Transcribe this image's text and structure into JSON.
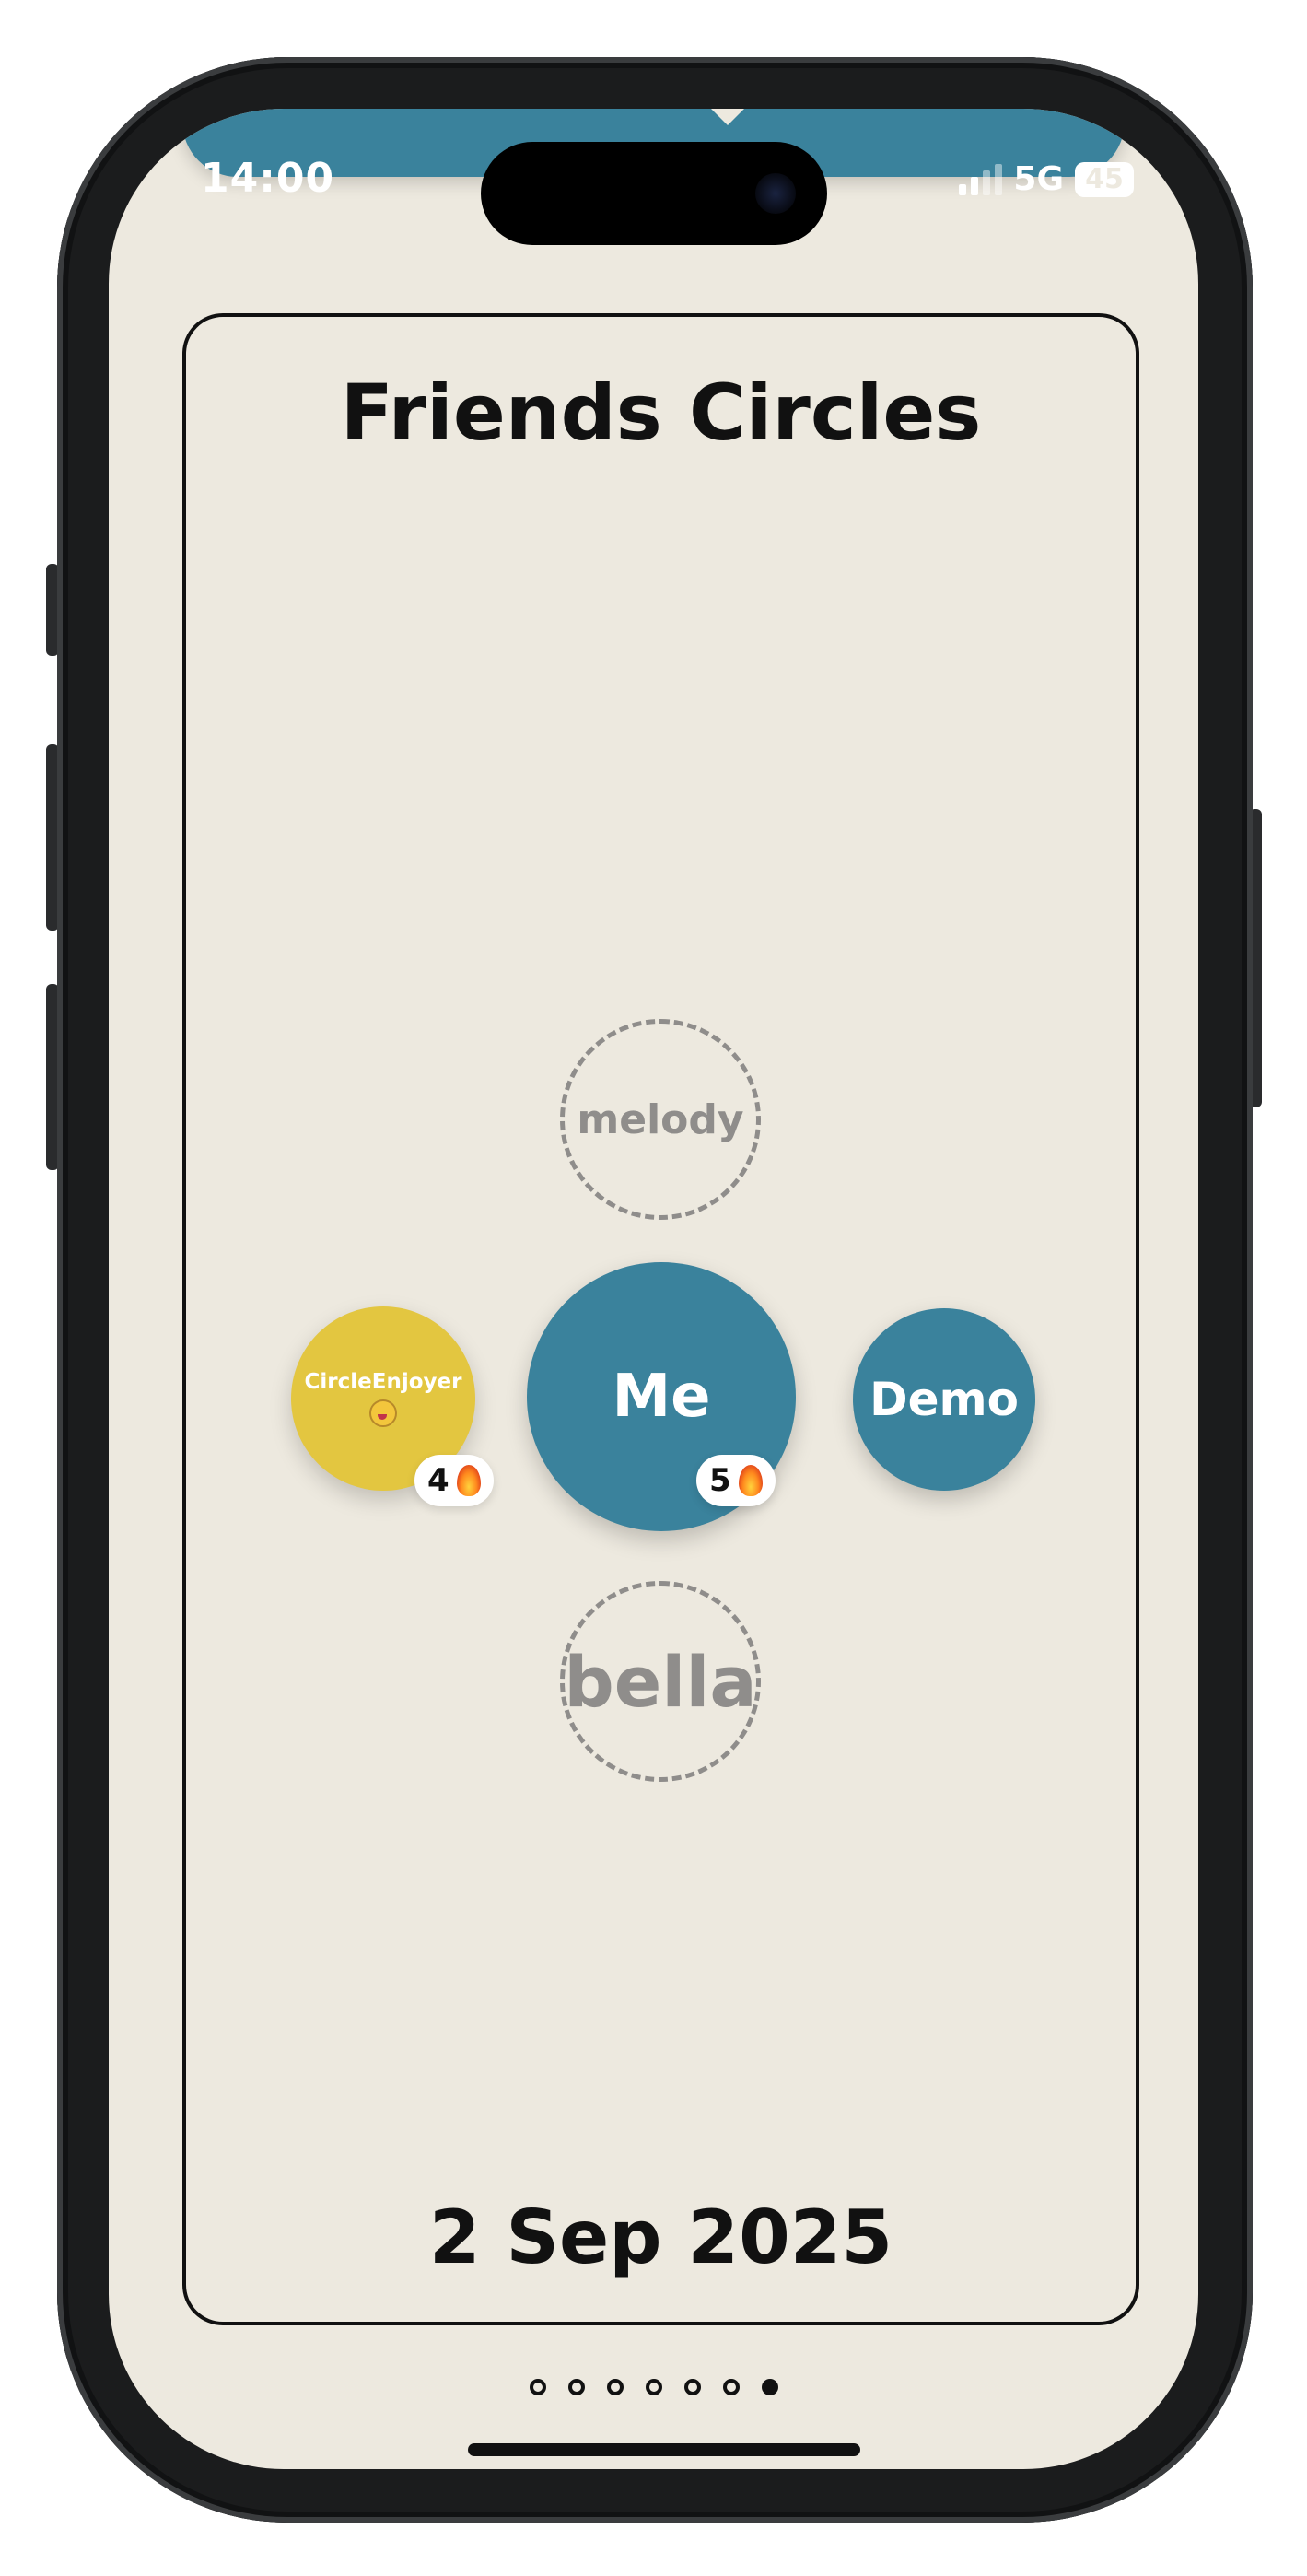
{
  "status_bar": {
    "time": "14:00",
    "network": "5G",
    "battery": "45"
  },
  "card": {
    "title": "Friends Circles",
    "date": "2 Sep 2025"
  },
  "circles": {
    "center": {
      "label": "Me",
      "streak": "5",
      "streak_icon": "fire-icon",
      "color": "#3a829c"
    },
    "top": {
      "label": "melody",
      "state": "pending"
    },
    "bottom": {
      "label": "bella",
      "state": "pending"
    },
    "left": {
      "label": "CircleEnjoyer",
      "emoji_icon": "zany-face-icon",
      "streak": "4",
      "streak_icon": "fire-icon",
      "color": "#e3c640"
    },
    "right": {
      "label": "Demo",
      "color": "#3a829c"
    }
  },
  "pager": {
    "total": 7,
    "active_index": 6
  },
  "colors": {
    "background": "#ede9df",
    "accent": "#3a829c",
    "yellow": "#e3c640",
    "pending": "#8f8d8b"
  }
}
